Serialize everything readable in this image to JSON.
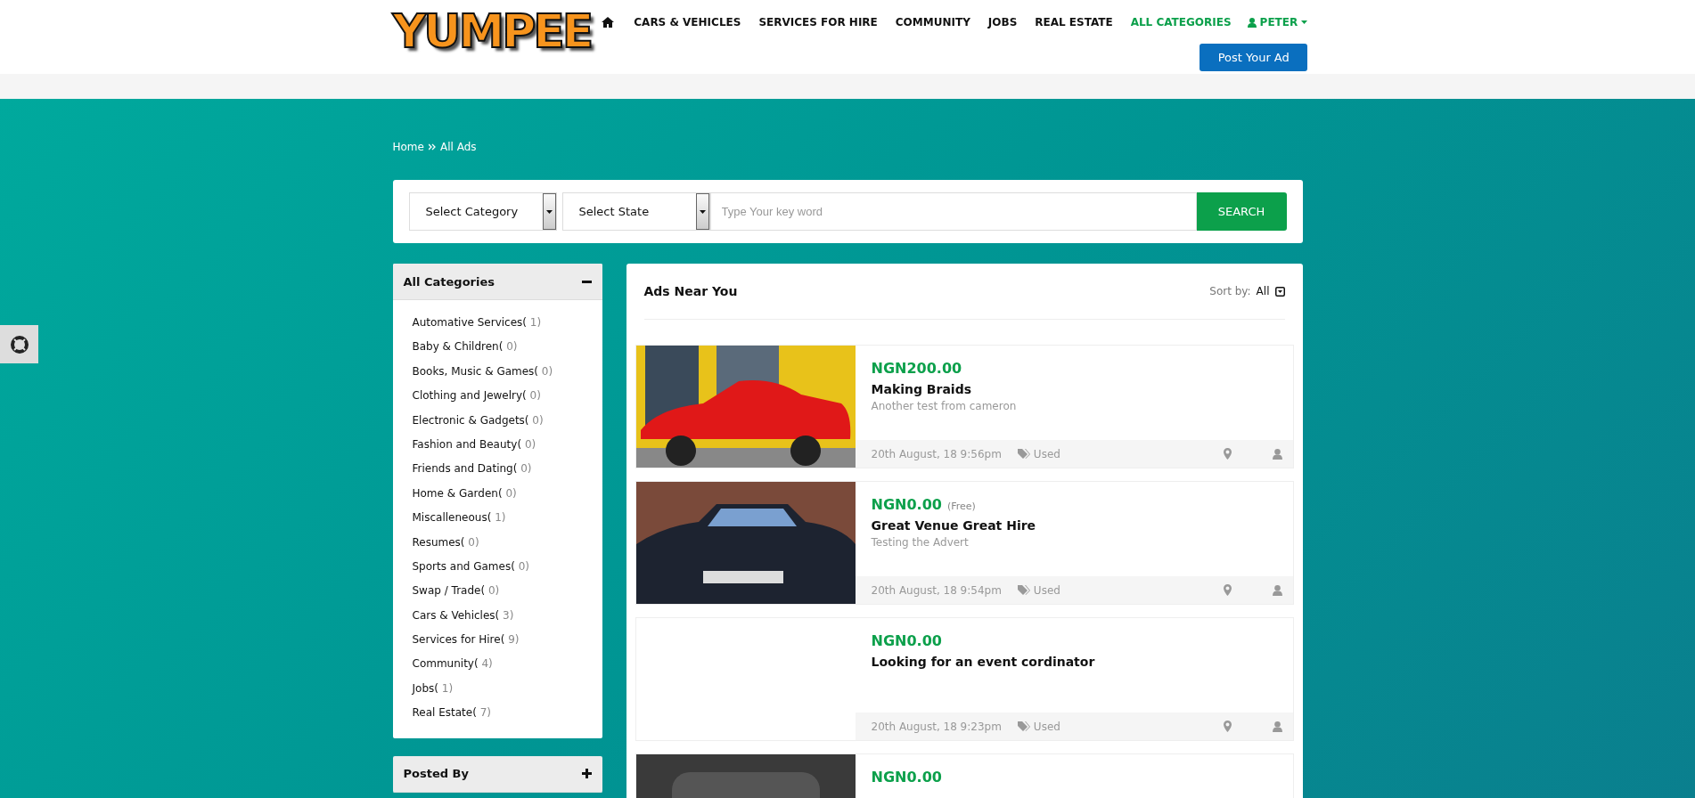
{
  "header": {
    "logo": "YUMPEE",
    "nav": [
      {
        "label": "CARS & VEHICLES",
        "selected": false
      },
      {
        "label": "SERVICES FOR HIRE",
        "selected": false
      },
      {
        "label": "COMMUNITY",
        "selected": false
      },
      {
        "label": "JOBS",
        "selected": false
      },
      {
        "label": "REAL ESTATE",
        "selected": false
      },
      {
        "label": "ALL CATEGORIES",
        "selected": true
      }
    ],
    "user": "PETER",
    "post_button": "Post Your Ad"
  },
  "breadcrumb": [
    "Home",
    "All Ads"
  ],
  "search": {
    "category": "Select Category",
    "state": "Select State",
    "placeholder": "Type Your key word",
    "button": "SEARCH"
  },
  "sidebar": [
    {
      "title": "All Categories",
      "expanded": true,
      "items": [
        {
          "name": "Automative Services(",
          "count": " 1)"
        },
        {
          "name": "Baby & Children(",
          "count": " 0)"
        },
        {
          "name": "Books, Music & Games(",
          "count": " 0)"
        },
        {
          "name": "Clothing and Jewelry(",
          "count": " 0)"
        },
        {
          "name": "Electronic & Gadgets(",
          "count": " 0)"
        },
        {
          "name": "Fashion and Beauty(",
          "count": " 0)"
        },
        {
          "name": "Friends and Dating(",
          "count": " 0)"
        },
        {
          "name": "Home & Garden(",
          "count": " 0)"
        },
        {
          "name": "Miscalleneous(",
          "count": " 1)"
        },
        {
          "name": "Resumes(",
          "count": " 0)"
        },
        {
          "name": "Sports and Games(",
          "count": " 0)"
        },
        {
          "name": "Swap / Trade(",
          "count": " 0)"
        },
        {
          "name": "Cars & Vehicles(",
          "count": " 3)"
        },
        {
          "name": "Services for Hire(",
          "count": " 9)"
        },
        {
          "name": "Community(",
          "count": " 4)"
        },
        {
          "name": "Jobs(",
          "count": " 1)"
        },
        {
          "name": "Real Estate(",
          "count": " 7)"
        }
      ]
    },
    {
      "title": "Posted By",
      "expanded": false
    }
  ],
  "ads": {
    "title": "Ads Near You",
    "sort_label": "Sort by:",
    "sort_value": "All",
    "items": [
      {
        "kind": "red-car",
        "price": "NGN200.00",
        "title": "Making Braids",
        "description": "Another test from cameron",
        "date": "20th August, 18 9:56pm",
        "condition": "Used"
      },
      {
        "kind": "dark-car",
        "price": "NGN0.00",
        "note": "(Free)",
        "title": "Great Venue Great Hire",
        "description": "Testing the Advert",
        "date": "20th August, 18 9:54pm",
        "condition": "Used"
      },
      {
        "kind": "no-photo",
        "price": "NGN0.00",
        "title": "Looking for an event cordinator",
        "date": "20th August, 18 9:23pm",
        "condition": "Used"
      },
      {
        "kind": "car-interior",
        "price": "NGN0.00"
      }
    ]
  }
}
